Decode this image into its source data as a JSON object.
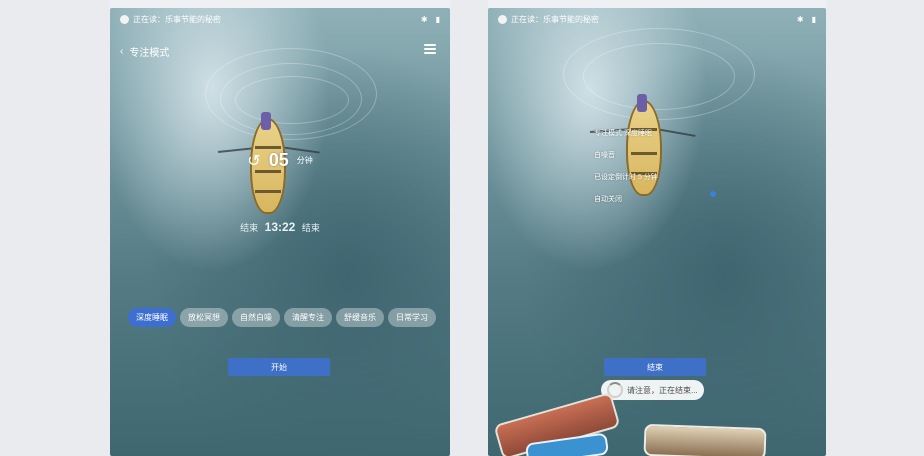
{
  "left": {
    "status_bar": {
      "reader_text": "正在读：乐事节能的秘密",
      "icons": [
        "bluetooth-icon",
        "signal-icon"
      ]
    },
    "header": {
      "title": "专注模式"
    },
    "timer": {
      "value": "05",
      "unit": "分钟"
    },
    "timeline": {
      "prefix": "结束",
      "clock": "13:22",
      "suffix": "结束"
    },
    "chips": [
      {
        "label": "深度睡眠",
        "active": true
      },
      {
        "label": "放松冥想",
        "active": false
      },
      {
        "label": "自然白噪",
        "active": false
      },
      {
        "label": "清醒专注",
        "active": false
      },
      {
        "label": "舒缓音乐",
        "active": false
      },
      {
        "label": "日常学习",
        "active": false
      }
    ],
    "start_button": {
      "label": "开始"
    }
  },
  "right": {
    "status_bar": {
      "reader_text": "正在读：乐事节能的秘密",
      "icons": [
        "bluetooth-icon",
        "signal-icon"
      ]
    },
    "mode_lines": [
      "专注模式 深度睡眠",
      "白噪音",
      "已设定倒计时 5 分钟",
      "自动关闭"
    ],
    "end_button": {
      "label": "结束"
    },
    "toast": {
      "text": "请注意，正在结束..."
    }
  },
  "colors": {
    "accent_blue": "#3f70c8",
    "chip_active": "#3d6fd1"
  }
}
